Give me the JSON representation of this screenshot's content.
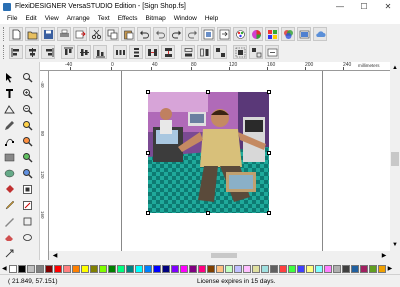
{
  "window": {
    "title": "FlexiDESIGNER VersaSTUDIO Edition - [Sign Shop.fs]",
    "minimize": "—",
    "maximize": "☐",
    "close": "✕"
  },
  "menu": [
    "File",
    "Edit",
    "View",
    "Arrange",
    "Text",
    "Effects",
    "Bitmap",
    "Window",
    "Help"
  ],
  "ruler": {
    "unit": "millimeters",
    "h_labels": [
      "-40",
      "0",
      "40",
      "80",
      "120",
      "160",
      "200",
      "240"
    ],
    "v_labels": [
      "-40",
      "80",
      "120",
      "160"
    ]
  },
  "status": {
    "coords": "( 21.849,    57.151)",
    "license": "License expires in 15 days."
  },
  "palette_colors": [
    "#ffffff",
    "#000000",
    "#c0c0c0",
    "#808080",
    "#800000",
    "#ff0000",
    "#ff8080",
    "#ff8000",
    "#ffff00",
    "#808000",
    "#80ff00",
    "#008000",
    "#00ff80",
    "#008080",
    "#00ffff",
    "#0080ff",
    "#0000ff",
    "#000080",
    "#8000ff",
    "#ff00ff",
    "#800080",
    "#ff0080",
    "#804000",
    "#ffc080",
    "#c0ffc0",
    "#c0c0ff",
    "#ffc0ff",
    "#e0e0a0",
    "#a0e0e0",
    "#606060",
    "#ff4040",
    "#40ff40",
    "#4040ff",
    "#ffff80",
    "#80ffff",
    "#ff80ff",
    "#b0b0b0",
    "#404040",
    "#2060a0",
    "#a02060",
    "#60a020",
    "#f0a000"
  ]
}
